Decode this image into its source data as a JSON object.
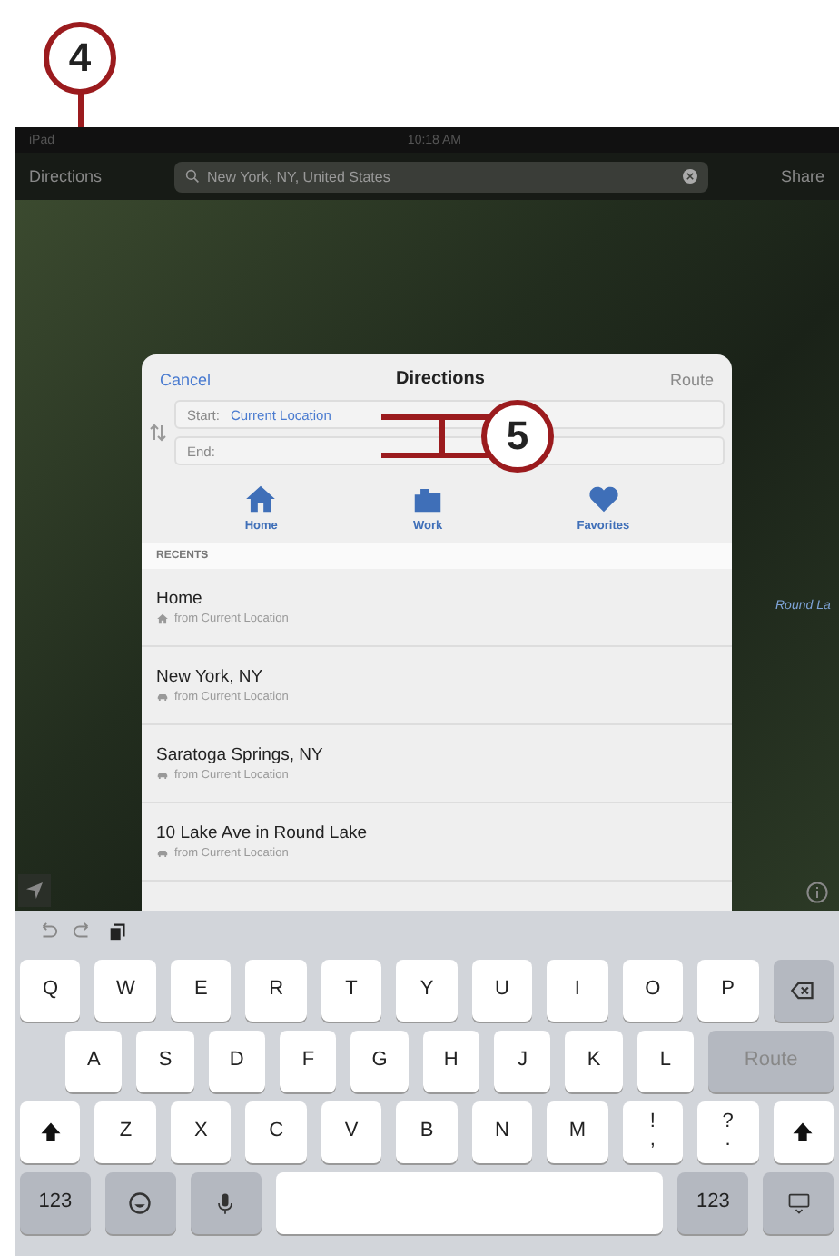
{
  "callouts": [
    {
      "number": "4"
    },
    {
      "number": "5"
    }
  ],
  "status_bar": {
    "device": "iPad",
    "time": "10:18 AM"
  },
  "nav_bar": {
    "directions_button": "Directions",
    "search": {
      "value": "New York, NY, United States"
    },
    "share_button": "Share"
  },
  "map": {
    "place_label": "Round La"
  },
  "directions_panel": {
    "cancel": "Cancel",
    "title": "Directions",
    "route": "Route",
    "route_disabled": true,
    "start": {
      "label": "Start:",
      "value": "Current Location"
    },
    "end": {
      "label": "End:"
    },
    "shortcuts": [
      {
        "kind": "home",
        "label": "Home"
      },
      {
        "kind": "work",
        "label": "Work"
      },
      {
        "kind": "favorites",
        "label": "Favorites"
      }
    ],
    "recents_header": "RECENTS",
    "recents": [
      {
        "title": "Home",
        "subtitle": "from Current Location",
        "kind": "home"
      },
      {
        "title": "New York, NY",
        "subtitle": "from Current Location",
        "kind": "car"
      },
      {
        "title": "Saratoga Springs, NY",
        "subtitle": "from Current Location",
        "kind": "car"
      },
      {
        "title": "10 Lake Ave in Round Lake",
        "subtitle": "from Current Location",
        "kind": "car"
      }
    ]
  },
  "keyboard": {
    "rows": [
      {
        "indent": false,
        "keys": [
          {
            "kind": "char",
            "label": "Q"
          },
          {
            "kind": "char",
            "label": "W"
          },
          {
            "kind": "char",
            "label": "E"
          },
          {
            "kind": "char",
            "label": "R"
          },
          {
            "kind": "char",
            "label": "T"
          },
          {
            "kind": "char",
            "label": "Y"
          },
          {
            "kind": "char",
            "label": "U"
          },
          {
            "kind": "char",
            "label": "I"
          },
          {
            "kind": "char",
            "label": "O"
          },
          {
            "kind": "char",
            "label": "P"
          },
          {
            "kind": "backspace"
          }
        ]
      },
      {
        "indent": true,
        "keys": [
          {
            "kind": "char",
            "label": "A"
          },
          {
            "kind": "char",
            "label": "S"
          },
          {
            "kind": "char",
            "label": "D"
          },
          {
            "kind": "char",
            "label": "F"
          },
          {
            "kind": "char",
            "label": "G"
          },
          {
            "kind": "char",
            "label": "H"
          },
          {
            "kind": "char",
            "label": "J"
          },
          {
            "kind": "char",
            "label": "K"
          },
          {
            "kind": "char",
            "label": "L"
          },
          {
            "kind": "return",
            "label": "Route"
          }
        ]
      },
      {
        "indent": false,
        "keys": [
          {
            "kind": "shift"
          },
          {
            "kind": "char",
            "label": "Z"
          },
          {
            "kind": "char",
            "label": "X"
          },
          {
            "kind": "char",
            "label": "C"
          },
          {
            "kind": "char",
            "label": "V"
          },
          {
            "kind": "char",
            "label": "B"
          },
          {
            "kind": "char",
            "label": "N"
          },
          {
            "kind": "char",
            "label": "M"
          },
          {
            "kind": "char",
            "label": "!\n,"
          },
          {
            "kind": "char",
            "label": "?\n."
          },
          {
            "kind": "shift"
          }
        ]
      },
      {
        "indent": false,
        "keys": [
          {
            "kind": "mode",
            "label": "123"
          },
          {
            "kind": "emoji"
          },
          {
            "kind": "mic"
          },
          {
            "kind": "space"
          },
          {
            "kind": "mode",
            "label": "123"
          },
          {
            "kind": "hide"
          }
        ]
      }
    ]
  }
}
